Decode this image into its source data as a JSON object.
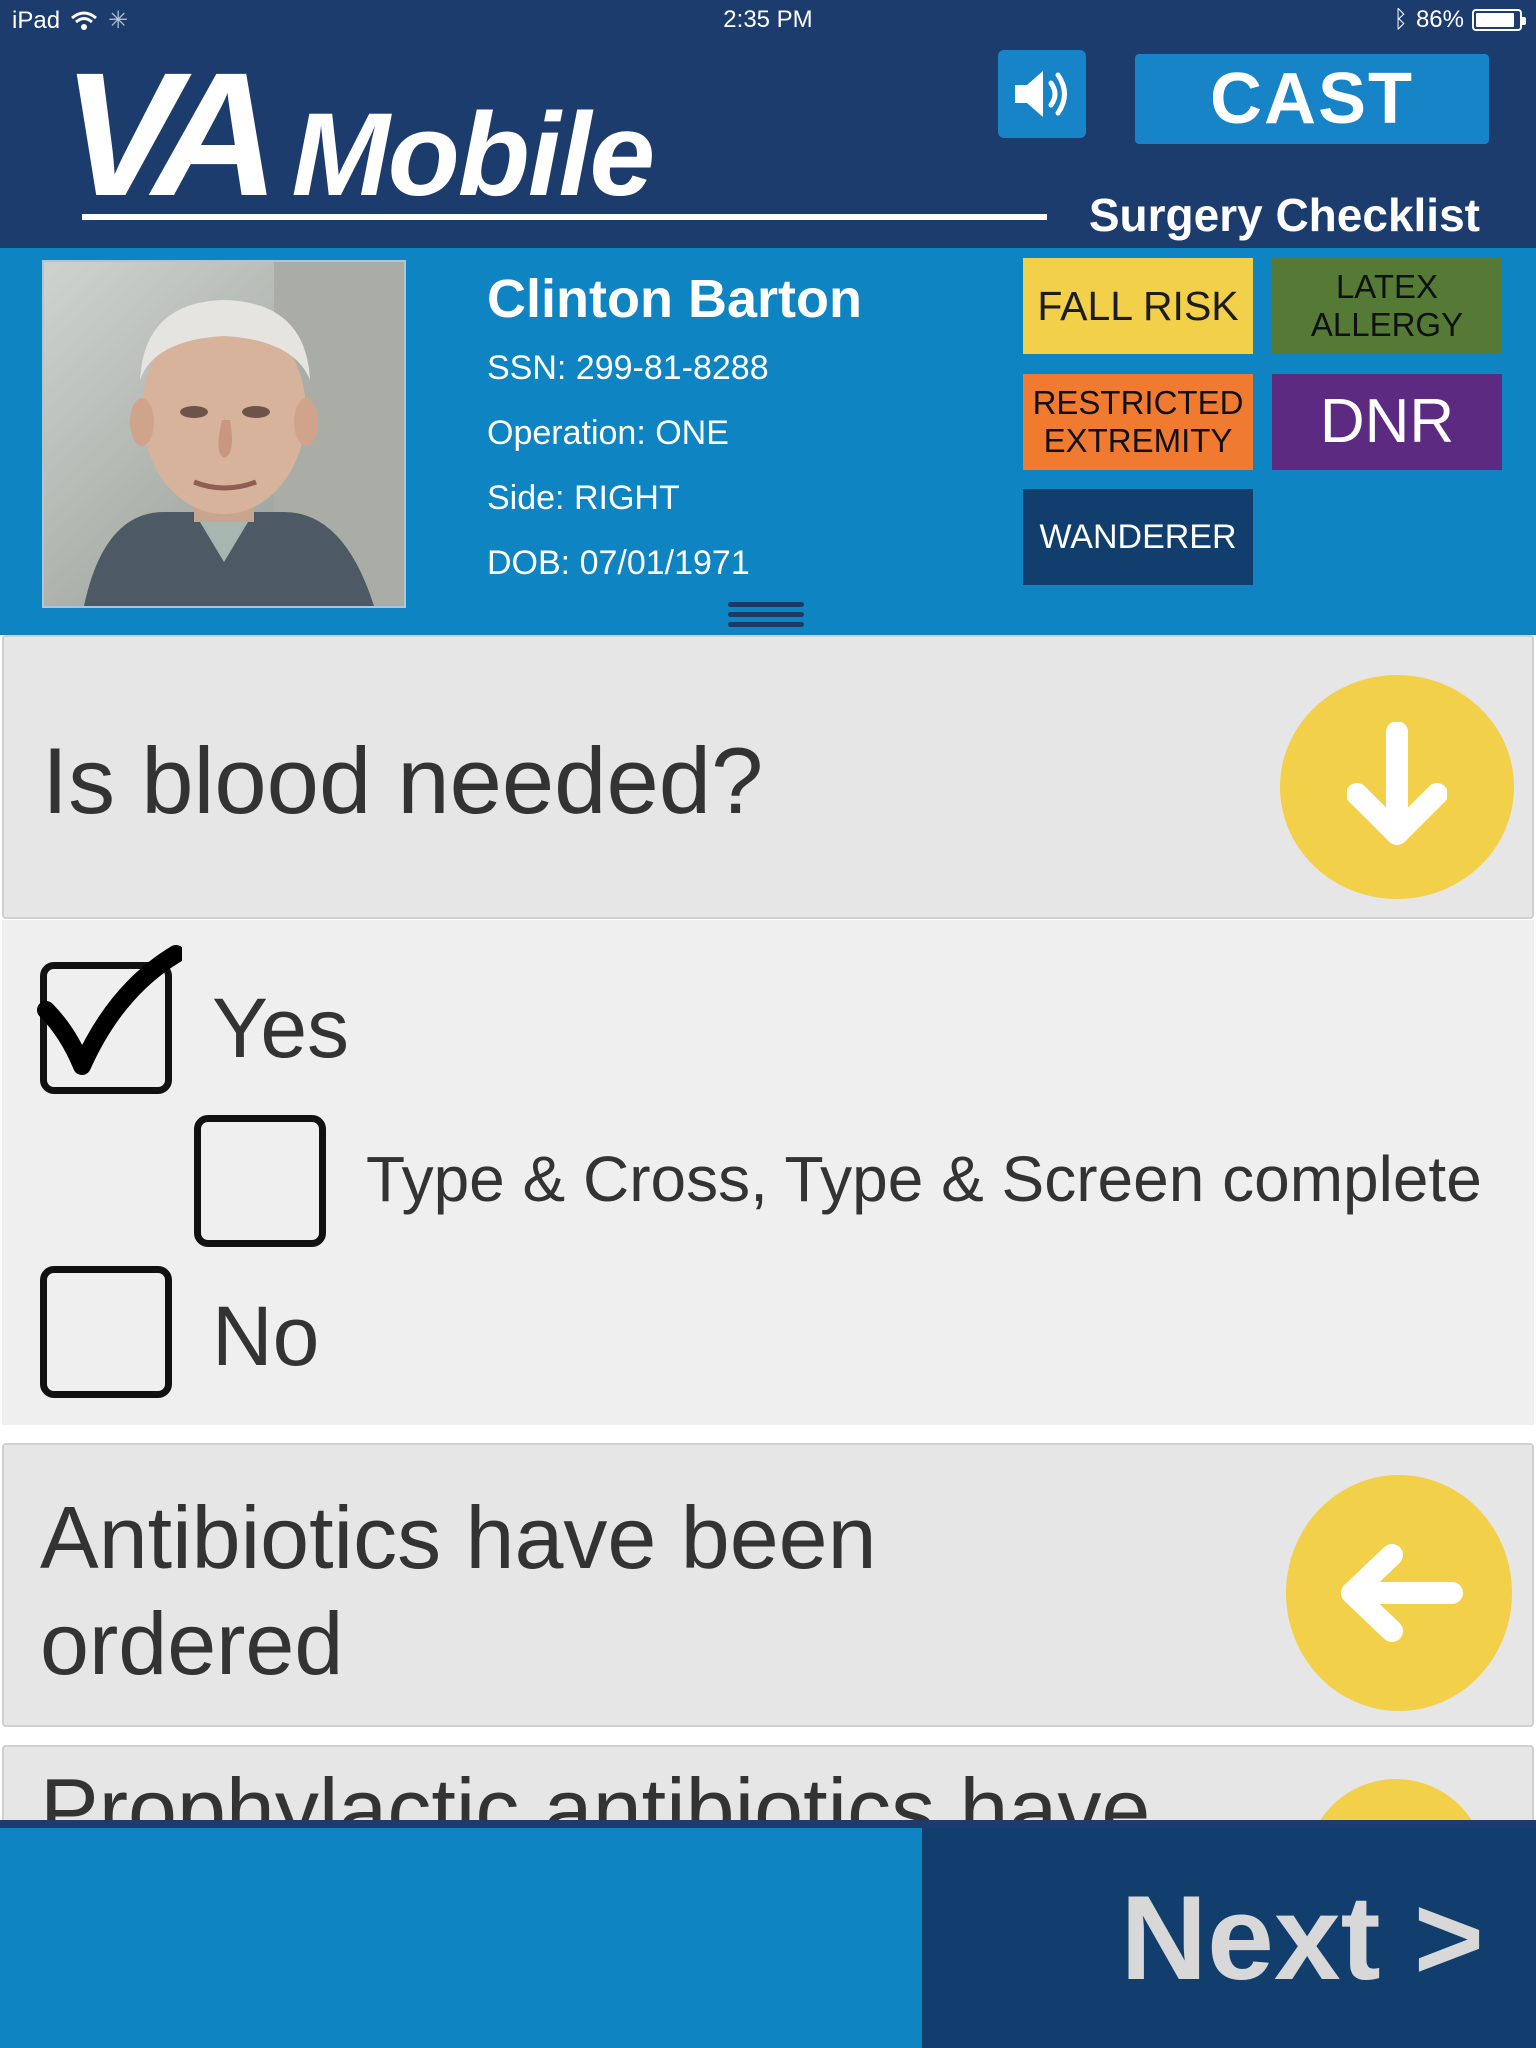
{
  "status_bar": {
    "device": "iPad",
    "time": "2:35 PM",
    "battery": "86%"
  },
  "header": {
    "logo_va": "VA",
    "logo_mobile": "Mobile",
    "cast_label": "CAST",
    "subtitle": "Surgery Checklist"
  },
  "patient": {
    "name": "Clinton Barton",
    "ssn": "SSN: 299-81-8288",
    "operation": "Operation: ONE",
    "side": "Side: RIGHT",
    "dob": "DOB: 07/01/1971",
    "alerts": {
      "fall_risk": "FALL RISK",
      "latex_allergy_1": "LATEX",
      "latex_allergy_2": "ALLERGY",
      "restricted_1": "RESTRICTED",
      "restricted_2": "EXTREMITY",
      "dnr": "DNR",
      "wanderer": "WANDERER"
    }
  },
  "checklist": {
    "q1": "Is blood needed?",
    "answers": {
      "yes": "Yes",
      "yes_checked": true,
      "sub": "Type & Cross, Type & Screen complete",
      "sub_checked": false,
      "no": "No",
      "no_checked": false
    },
    "q2_line1": "Antibiotics have been",
    "q2_line2": "ordered",
    "q3": "Prophylactic antibiotics have"
  },
  "footer": {
    "next_label": "Next >"
  },
  "colors": {
    "navy": "#1d3c6e",
    "blue": "#0e84c3",
    "yellow": "#f2d04a",
    "green": "#547a35",
    "orange": "#f07a30",
    "purple": "#5d2a82",
    "dark_navy": "#123e6d"
  },
  "icons": [
    "wifi-icon",
    "bluetooth-icon",
    "battery-icon",
    "speaker-icon",
    "arrow-down-icon",
    "arrow-left-icon",
    "checkmark-icon",
    "drag-handle-icon"
  ]
}
